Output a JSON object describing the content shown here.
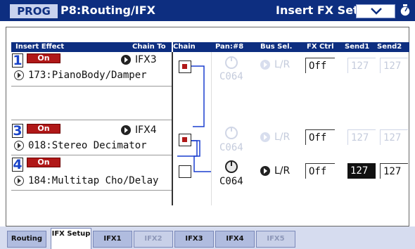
{
  "header": {
    "mode": "PROG",
    "page_name": "P8:Routing/IFX",
    "page_title": "Insert FX Setup"
  },
  "columns": {
    "insert_effect": "Insert Effect",
    "chain_to": "Chain To",
    "chain": "Chain",
    "pan": "Pan:#8",
    "bus_sel": "Bus Sel.",
    "fx_ctrl": "FX Ctrl",
    "send1": "Send1",
    "send2": "Send2"
  },
  "slots": [
    {
      "number": "1",
      "on_label": "On",
      "chain_to": "IFX3",
      "effect": "173:PianoBody/Damper",
      "pan": "C064",
      "bus": "L/R",
      "fx_ctrl": "Off",
      "send1": "127",
      "send2": "127"
    },
    {
      "number": "3",
      "on_label": "On",
      "chain_to": "IFX4",
      "effect": "018:Stereo Decimator",
      "pan": "C064",
      "bus": "L/R",
      "fx_ctrl": "Off",
      "send1": "127",
      "send2": "127"
    },
    {
      "number": "4",
      "on_label": "On",
      "effect": "184:Multitap Cho/Delay",
      "pan": "C064",
      "bus": "L/R",
      "fx_ctrl": "Off",
      "send1": "127",
      "send2": "127"
    }
  ],
  "tabs": [
    {
      "label": "Routing"
    },
    {
      "label": "IFX Setup"
    },
    {
      "label": "IFX1"
    },
    {
      "label": "IFX2"
    },
    {
      "label": "IFX3"
    },
    {
      "label": "IFX4"
    },
    {
      "label": "IFX5"
    }
  ],
  "colors": {
    "title_bar": "#0d2e80",
    "on_button": "#b01818",
    "number_blue": "#1a44c8",
    "route_line": "#1a3fcf"
  }
}
